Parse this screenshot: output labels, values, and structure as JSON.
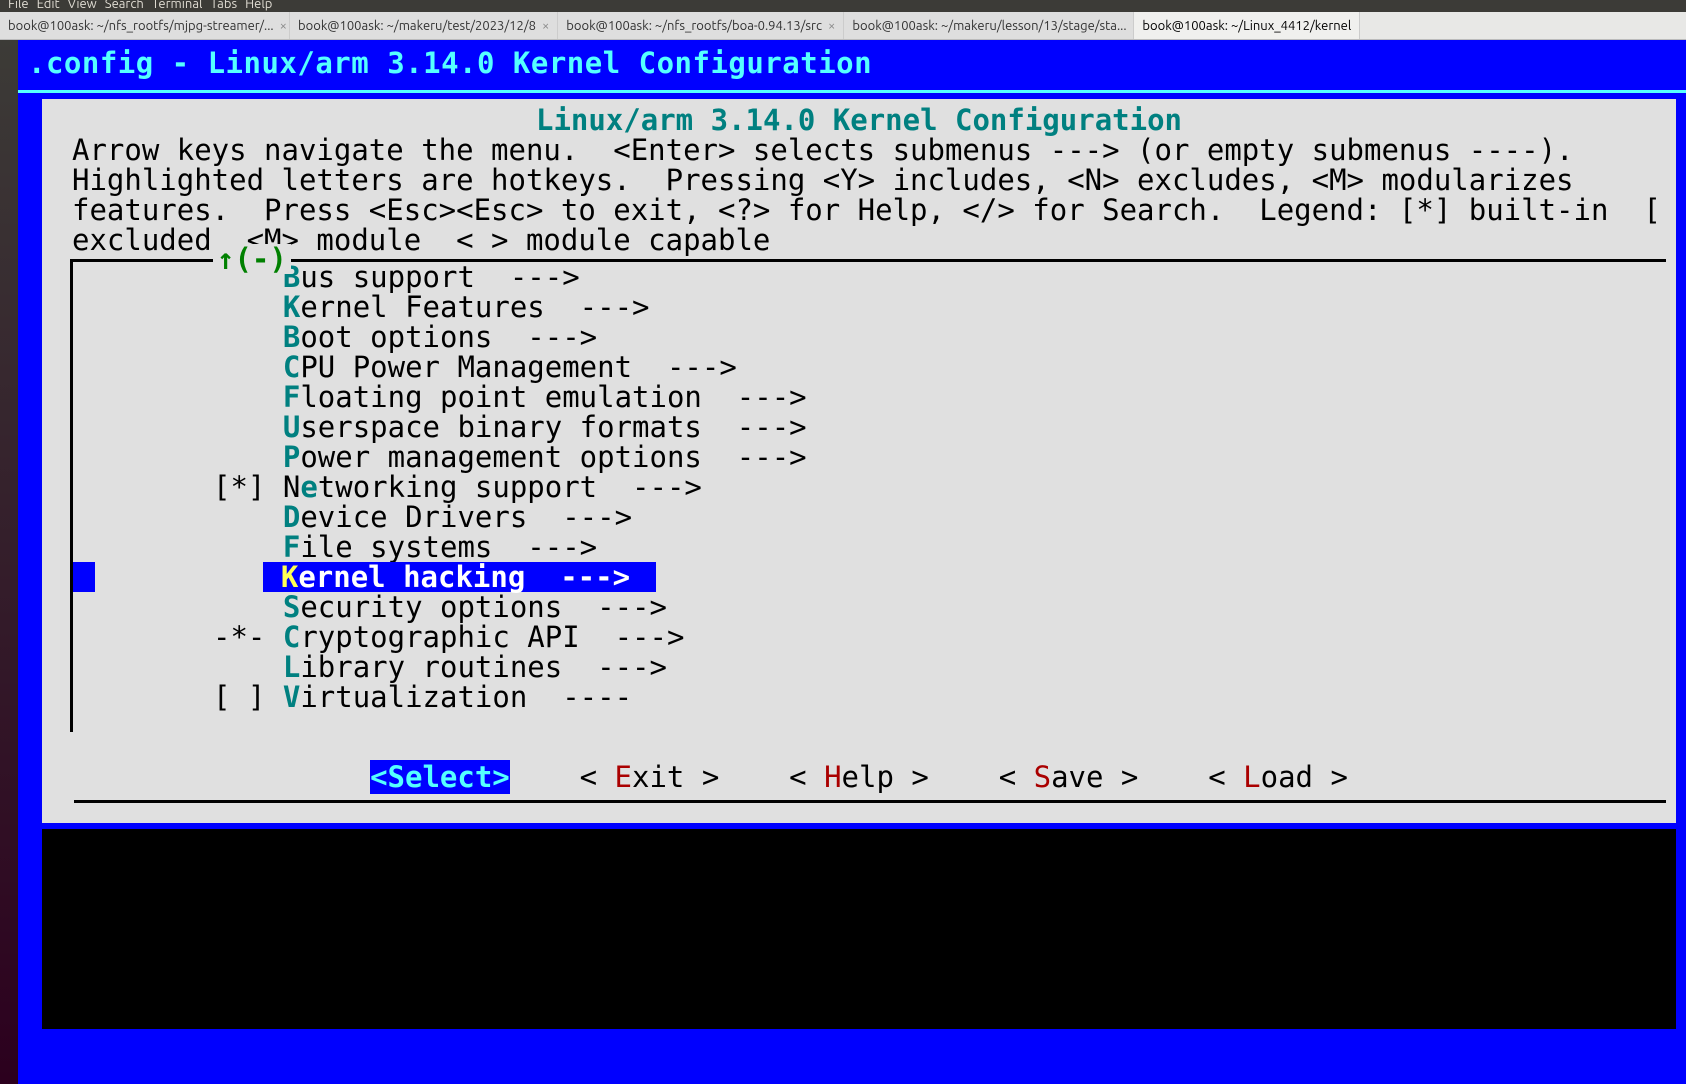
{
  "menubar": [
    "File",
    "Edit",
    "View",
    "Search",
    "Terminal",
    "Tabs",
    "Help"
  ],
  "tabs": [
    {
      "label": "book@100ask: ~/nfs_rootfs/mjpg-streamer/...",
      "active": false
    },
    {
      "label": "book@100ask: ~/makeru/test/2023/12/8",
      "active": false
    },
    {
      "label": "book@100ask: ~/nfs_rootfs/boa-0.94.13/src",
      "active": false
    },
    {
      "label": "book@100ask: ~/makeru/lesson/13/stage/sta...",
      "active": false
    },
    {
      "label": "book@100ask: ~/Linux_4412/kernel",
      "active": true
    }
  ],
  "term_title": ".config - Linux/arm 3.14.0 Kernel Configuration",
  "config_title": "Linux/arm 3.14.0 Kernel Configuration",
  "help_text": "Arrow keys navigate the menu.  <Enter> selects submenus ---> (or empty submenus ----).\nHighlighted letters are hotkeys.  Pressing <Y> includes, <N> excludes, <M> modularizes\nfeatures.  Press <Esc><Esc> to exit, <?> for Help, </> for Search.  Legend: [*] built-in  [\nexcluded  <M> module  < > module capable",
  "scroll_indicator": "↑(-)",
  "menu": [
    {
      "prefix": "    ",
      "hot": "B",
      "rest": "us support  --->"
    },
    {
      "prefix": "    ",
      "hot": "K",
      "rest": "ernel Features  --->"
    },
    {
      "prefix": "    ",
      "hot": "B",
      "rest": "oot options  --->"
    },
    {
      "prefix": "    ",
      "hot": "C",
      "rest": "PU Power Management  --->"
    },
    {
      "prefix": "    ",
      "hot": "F",
      "rest": "loating point emulation  --->"
    },
    {
      "prefix": "    ",
      "hot": "U",
      "rest": "serspace binary formats  --->"
    },
    {
      "prefix": "    ",
      "hot": "P",
      "rest": "ower management options  --->"
    },
    {
      "prefix": "[*] ",
      "hot": "N",
      "rest": "etworking support  --->",
      "hotpos": 1
    },
    {
      "prefix": "    ",
      "hot": "D",
      "rest": "evice Drivers  --->"
    },
    {
      "prefix": "    ",
      "hot": "F",
      "rest": "ile systems  --->"
    },
    {
      "prefix": "    ",
      "hot": "K",
      "rest": "ernel hacking  --->",
      "selected": true
    },
    {
      "prefix": "    ",
      "hot": "S",
      "rest": "ecurity options  --->"
    },
    {
      "prefix": "-*- ",
      "hot": "C",
      "rest": "ryptographic API  --->"
    },
    {
      "prefix": "    ",
      "hot": "L",
      "rest": "ibrary routines  --->"
    },
    {
      "prefix": "[ ] ",
      "hot": "V",
      "rest": "irtualization  ----"
    }
  ],
  "networking_special": {
    "before": "[*] N",
    "hot": "e",
    "after": "tworking support  --->"
  },
  "buttons": {
    "select": "<Select>",
    "exit_l": "< ",
    "exit_h": "E",
    "exit_r": "xit >",
    "help_l": "< ",
    "help_h": "H",
    "help_r": "elp >",
    "save_l": "< ",
    "save_h": "S",
    "save_r": "ave >",
    "load_l": "< ",
    "load_h": "L",
    "load_r": "oad >"
  }
}
